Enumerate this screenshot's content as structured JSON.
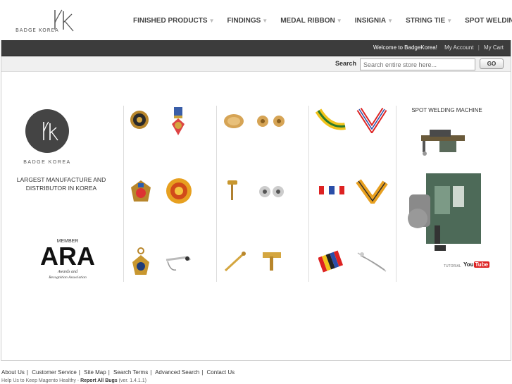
{
  "brand": {
    "name": "BADGE KOREA",
    "big_name": "BADGE KOREA",
    "tagline": "LARGEST MANUFACTURE AND DISTRIBUTOR IN KOREA"
  },
  "nav": [
    {
      "label": "FINISHED PRODUCTS"
    },
    {
      "label": "FINDINGS"
    },
    {
      "label": "MEDAL RIBBON"
    },
    {
      "label": "INSIGNIA"
    },
    {
      "label": "STRING TIE"
    },
    {
      "label": "SPOT WELDING"
    }
  ],
  "topbar": {
    "welcome": "Welcome to BadgeKorea!",
    "my_account": "My Account",
    "my_cart": "My Cart"
  },
  "search": {
    "label": "Search",
    "placeholder": "Search entire store here...",
    "button": "GO"
  },
  "ara": {
    "member": "MEMBER",
    "acronym": "ARA",
    "line1": "Awards and",
    "line2": "Recognition Association"
  },
  "spot": {
    "title": "SPOT WELDING MACHINE",
    "tutorial": "TUTORIAL",
    "you": "You",
    "tube": "Tube"
  },
  "footer": {
    "links": [
      "About Us",
      "Customer Service",
      "Site Map",
      "Search Terms",
      "Advanced Search",
      "Contact Us"
    ],
    "help_prefix": "Help Us to Keep Magento Healthy - ",
    "help_bold": "Report All Bugs",
    "help_suffix": " (ver. 1.4.1.1)"
  },
  "colors": {
    "topbar": "#3c3c3c",
    "gold": "#c8972f",
    "accent_red": "#d22"
  }
}
